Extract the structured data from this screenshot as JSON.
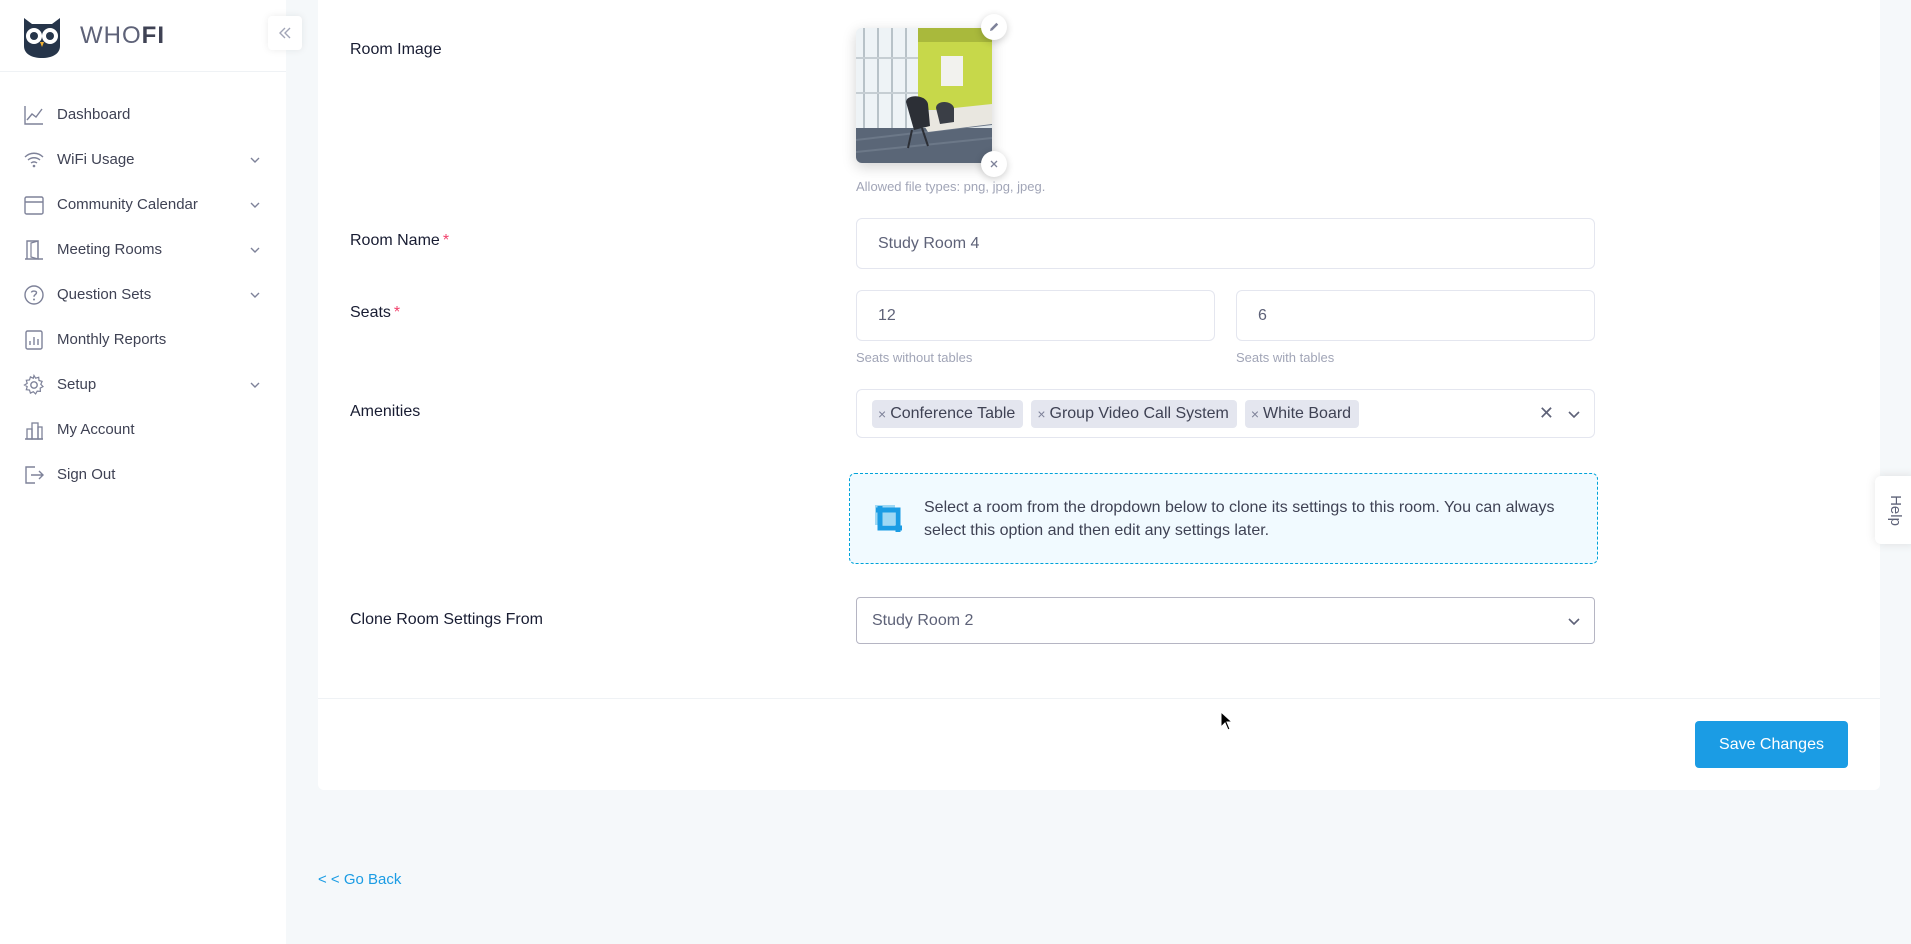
{
  "brand": {
    "logo_icon": "owl-logo",
    "name_part1": "WHO",
    "name_part2": "FI"
  },
  "sidebar": {
    "collapse_icon": "double-chevron-left-icon",
    "items": [
      {
        "label": "Dashboard",
        "icon": "chart-line-icon",
        "has_submenu": false
      },
      {
        "label": "WiFi Usage",
        "icon": "wifi-icon",
        "has_submenu": true
      },
      {
        "label": "Community Calendar",
        "icon": "calendar-icon",
        "has_submenu": true
      },
      {
        "label": "Meeting Rooms",
        "icon": "door-icon",
        "has_submenu": true
      },
      {
        "label": "Question Sets",
        "icon": "question-circle-icon",
        "has_submenu": true
      },
      {
        "label": "Monthly Reports",
        "icon": "report-icon",
        "has_submenu": false
      },
      {
        "label": "Setup",
        "icon": "gear-icon",
        "has_submenu": true
      },
      {
        "label": "My Account",
        "icon": "building-icon",
        "has_submenu": false
      },
      {
        "label": "Sign Out",
        "icon": "sign-out-icon",
        "has_submenu": false
      }
    ]
  },
  "form": {
    "room_image": {
      "label": "Room Image",
      "hint": "Allowed file types: png, jpg, jpeg."
    },
    "room_name": {
      "label": "Room Name",
      "required_mark": "*",
      "value": "Study Room 4"
    },
    "seats": {
      "label": "Seats",
      "required_mark": "*",
      "without_tables_value": "12",
      "without_tables_hint": "Seats without tables",
      "with_tables_value": "6",
      "with_tables_hint": "Seats with tables"
    },
    "amenities": {
      "label": "Amenities",
      "tags": [
        "Conference Table",
        "Group Video Call System",
        "White Board"
      ],
      "tag_remove_glyph": "×",
      "clear_glyph": "✕"
    },
    "clone_notice": {
      "text": "Select a room from the dropdown below to clone its settings to this room. You can always select this option and then edit any settings later."
    },
    "clone_from": {
      "label": "Clone Room Settings From",
      "selected": "Study Room 2"
    },
    "save_label": "Save Changes"
  },
  "go_back_label": "< < Go Back",
  "help_label": "Help",
  "colors": {
    "accent": "#1b9ce4",
    "notice_border": "#00a3d9",
    "notice_bg": "#f1faff",
    "required": "#f1416c",
    "page_bg": "#f5f8fa"
  }
}
